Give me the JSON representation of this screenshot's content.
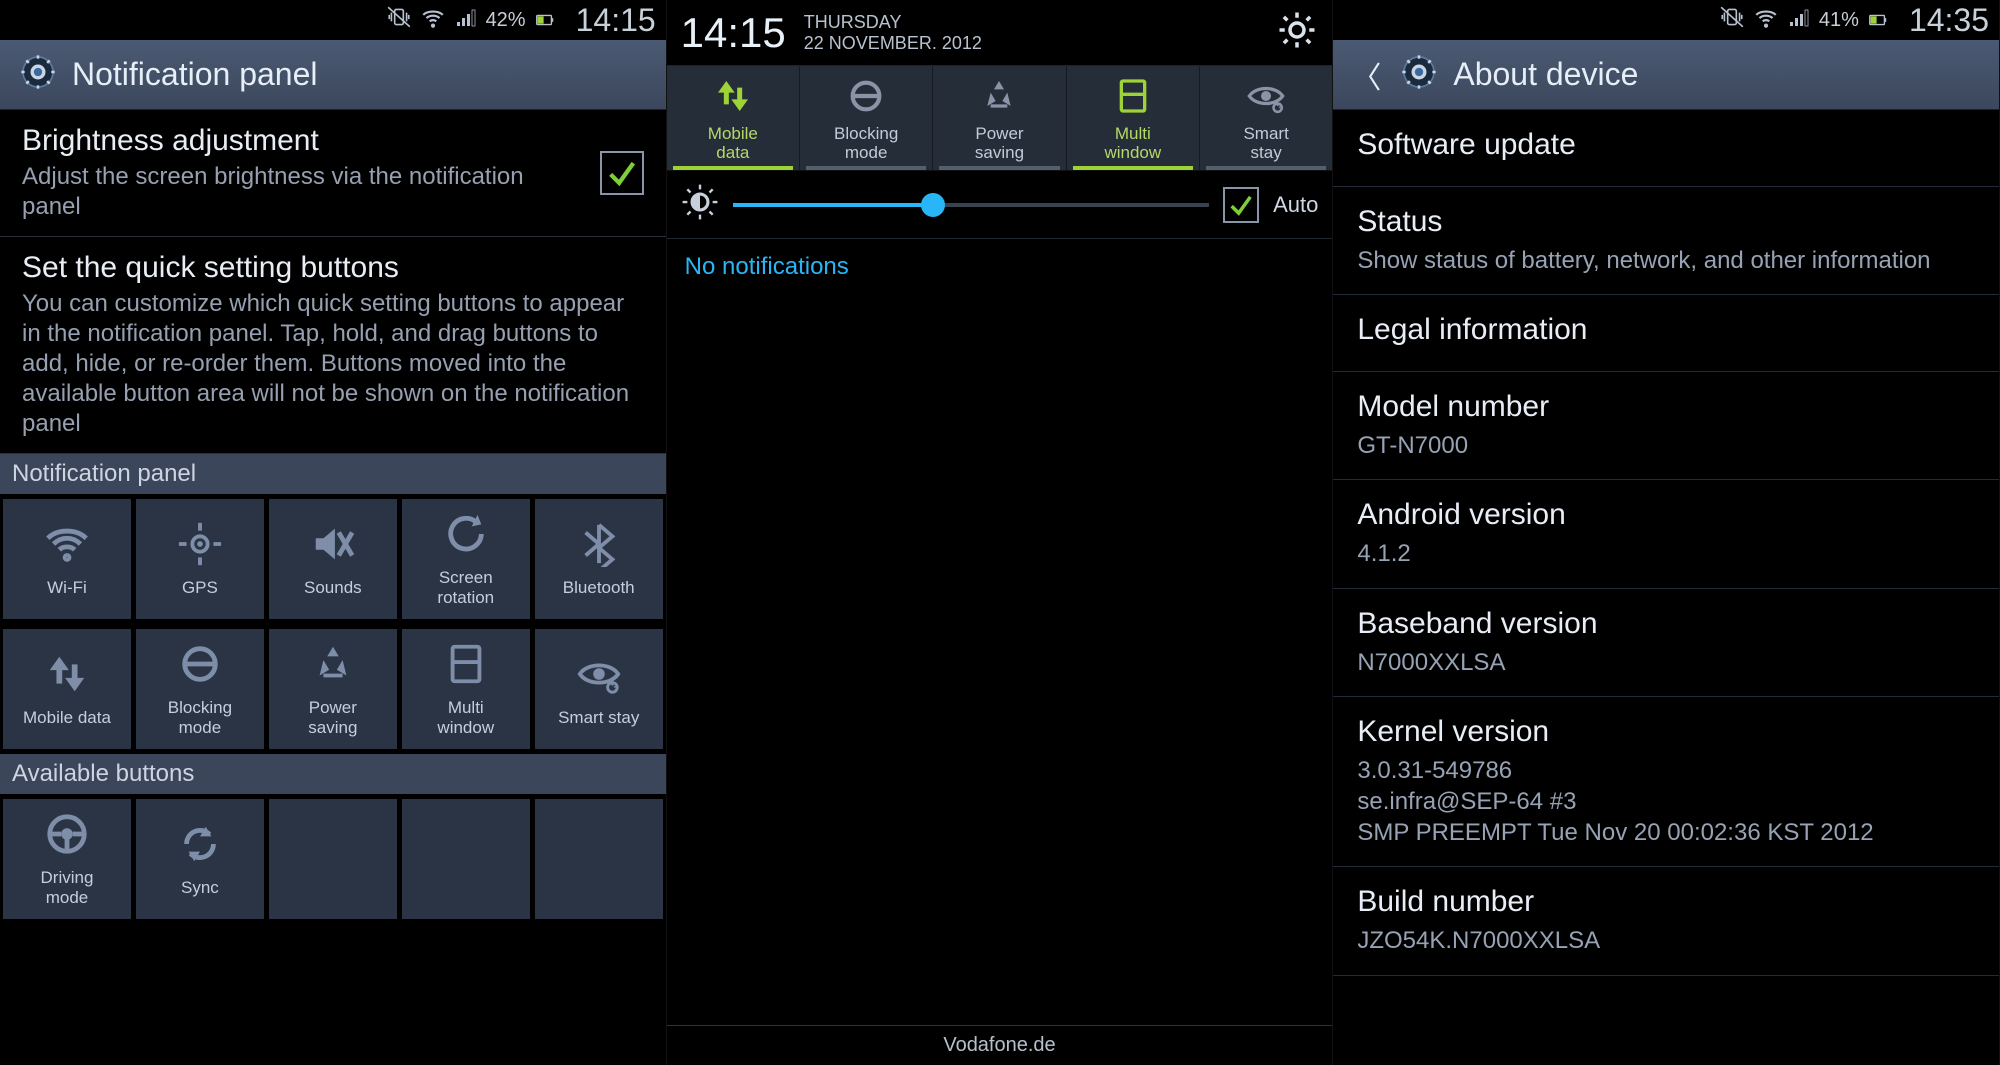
{
  "screen1": {
    "status": {
      "battery": "42%",
      "time": "14:15"
    },
    "header": {
      "title": "Notification panel"
    },
    "brightness": {
      "title": "Brightness adjustment",
      "sub": "Adjust the screen brightness via the notification panel",
      "checked": true
    },
    "quick": {
      "title": "Set the quick setting buttons",
      "sub": "You can customize which quick setting buttons to appear in the notification panel. Tap, hold, and drag buttons to add, hide, or re-order them. Buttons moved into the available button area will not be shown on the notification panel"
    },
    "section_panel": "Notification panel",
    "section_avail": "Available buttons",
    "tiles1": [
      {
        "label": "Wi-Fi",
        "icon": "wifi"
      },
      {
        "label": "GPS",
        "icon": "gps"
      },
      {
        "label": "Sounds",
        "icon": "sound-off"
      },
      {
        "label": "Screen\nrotation",
        "icon": "rotate"
      },
      {
        "label": "Bluetooth",
        "icon": "bluetooth"
      }
    ],
    "tiles2": [
      {
        "label": "Mobile data",
        "icon": "data-arrows"
      },
      {
        "label": "Blocking\nmode",
        "icon": "blocking"
      },
      {
        "label": "Power\nsaving",
        "icon": "recycle"
      },
      {
        "label": "Multi\nwindow",
        "icon": "multiwin"
      },
      {
        "label": "Smart stay",
        "icon": "eye"
      }
    ],
    "tiles3": [
      {
        "label": "Driving\nmode",
        "icon": "wheel"
      },
      {
        "label": "Sync",
        "icon": "sync"
      }
    ]
  },
  "screen2": {
    "clock": "14:15",
    "day": "THURSDAY",
    "date": "22 NOVEMBER. 2012",
    "toggles": [
      {
        "label": "Mobile\ndata",
        "icon": "data-arrows",
        "on": true
      },
      {
        "label": "Blocking\nmode",
        "icon": "blocking",
        "on": false
      },
      {
        "label": "Power\nsaving",
        "icon": "recycle",
        "on": false
      },
      {
        "label": "Multi\nwindow",
        "icon": "multiwin",
        "on": true
      },
      {
        "label": "Smart\nstay",
        "icon": "eye",
        "on": false
      }
    ],
    "brightness": {
      "auto_label": "Auto",
      "value_pct": 42
    },
    "empty": "No notifications",
    "carrier": "Vodafone.de"
  },
  "screen3": {
    "status": {
      "battery": "41%",
      "time": "14:35"
    },
    "header": {
      "title": "About device"
    },
    "items": [
      {
        "label": "Software update",
        "value": ""
      },
      {
        "label": "Status",
        "value": "Show status of battery, network, and other information"
      },
      {
        "label": "Legal information",
        "value": ""
      },
      {
        "label": "Model number",
        "value": "GT-N7000"
      },
      {
        "label": "Android version",
        "value": "4.1.2"
      },
      {
        "label": "Baseband version",
        "value": "N7000XXLSA"
      },
      {
        "label": "Kernel version",
        "value": "3.0.31-549786\nse.infra@SEP-64 #3\nSMP PREEMPT Tue Nov 20 00:02:36 KST 2012"
      },
      {
        "label": "Build number",
        "value": "JZO54K.N7000XXLSA"
      }
    ]
  }
}
